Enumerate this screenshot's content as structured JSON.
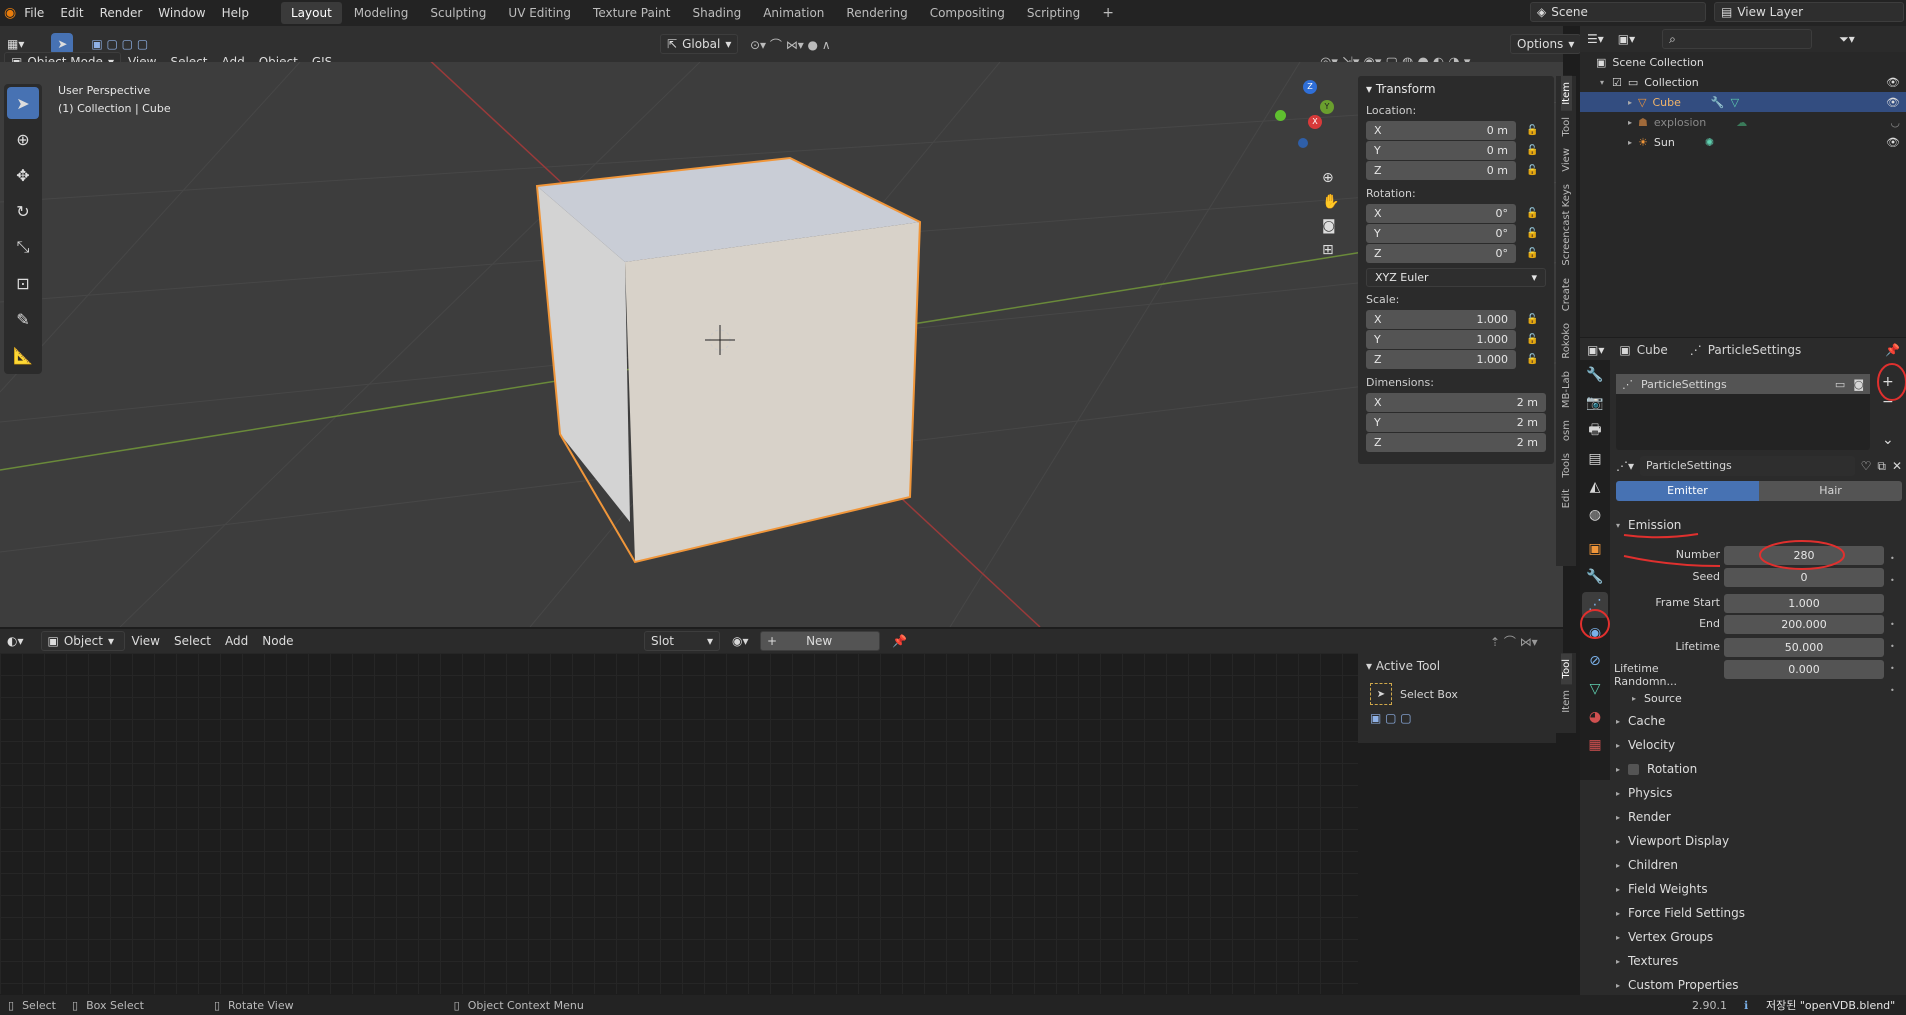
{
  "topbar": {
    "menus": [
      "File",
      "Edit",
      "Render",
      "Window",
      "Help"
    ],
    "workspaces": [
      "Layout",
      "Modeling",
      "Sculpting",
      "UV Editing",
      "Texture Paint",
      "Shading",
      "Animation",
      "Rendering",
      "Compositing",
      "Scripting"
    ],
    "active_workspace": "Layout",
    "scene": "Scene",
    "view_layer": "View Layer"
  },
  "viewport_header": {
    "mode": "Object Mode",
    "menus": [
      "View",
      "Select",
      "Add",
      "Object",
      "GIS"
    ],
    "transform_orientation": "Global",
    "options": "Options"
  },
  "viewport": {
    "perspective": "User Perspective",
    "collection_info": "(1) Collection | Cube",
    "gizmo": {
      "x": "X",
      "y": "Y",
      "z": "Z"
    }
  },
  "npanel": {
    "title": "Transform",
    "location_label": "Location:",
    "location": [
      {
        "axis": "X",
        "value": "0 m"
      },
      {
        "axis": "Y",
        "value": "0 m"
      },
      {
        "axis": "Z",
        "value": "0 m"
      }
    ],
    "rotation_label": "Rotation:",
    "rotation": [
      {
        "axis": "X",
        "value": "0°"
      },
      {
        "axis": "Y",
        "value": "0°"
      },
      {
        "axis": "Z",
        "value": "0°"
      }
    ],
    "rotation_mode": "XYZ Euler",
    "scale_label": "Scale:",
    "scale": [
      {
        "axis": "X",
        "value": "1.000"
      },
      {
        "axis": "Y",
        "value": "1.000"
      },
      {
        "axis": "Z",
        "value": "1.000"
      }
    ],
    "dimensions_label": "Dimensions:",
    "dimensions": [
      {
        "axis": "X",
        "value": "2 m"
      },
      {
        "axis": "Y",
        "value": "2 m"
      },
      {
        "axis": "Z",
        "value": "2 m"
      }
    ],
    "tabs": [
      "Item",
      "Tool",
      "View",
      "Screencast Keys",
      "Create",
      "Rokoko",
      "MB-Lab",
      "osm",
      "Tools",
      "Edit"
    ]
  },
  "outliner": {
    "root": "Scene Collection",
    "collection": "Collection",
    "items": [
      "Cube",
      "explosion",
      "Sun"
    ]
  },
  "properties": {
    "breadcrumb_object": "Cube",
    "breadcrumb_settings": "ParticleSettings",
    "list_item": "ParticleSettings",
    "datablock": "ParticleSettings",
    "type_tabs": [
      "Emitter",
      "Hair"
    ],
    "active_type": "Emitter",
    "emission_title": "Emission",
    "fields": [
      {
        "label": "Number",
        "value": "280"
      },
      {
        "label": "Seed",
        "value": "0"
      },
      {
        "label": "Frame Start",
        "value": "1.000"
      },
      {
        "label": "End",
        "value": "200.000"
      },
      {
        "label": "Lifetime",
        "value": "50.000"
      },
      {
        "label": "Lifetime Randomn...",
        "value": "0.000"
      }
    ],
    "source": "Source",
    "sections": [
      "Cache",
      "Velocity",
      "Rotation",
      "Physics",
      "Render",
      "Viewport Display",
      "Children",
      "Field Weights",
      "Force Field Settings",
      "Vertex Groups",
      "Textures",
      "Custom Properties"
    ]
  },
  "node_editor": {
    "object_type": "Object",
    "menus": [
      "View",
      "Select",
      "Add",
      "Node"
    ],
    "slot": "Slot",
    "new_button": "New",
    "tabs": [
      "Tool",
      "Item"
    ],
    "active_tool_title": "Active Tool",
    "active_tool": "Select Box"
  },
  "statusbar": {
    "select": "Select",
    "box_select": "Box Select",
    "rotate": "Rotate View",
    "context": "Object Context Menu",
    "version": "2.90.1",
    "saved": "저장된 \"openVDB.blend\""
  },
  "colors": {
    "accent": "#4772b3",
    "selected_orange": "#f0963a",
    "annotation_red": "#e0302e"
  }
}
